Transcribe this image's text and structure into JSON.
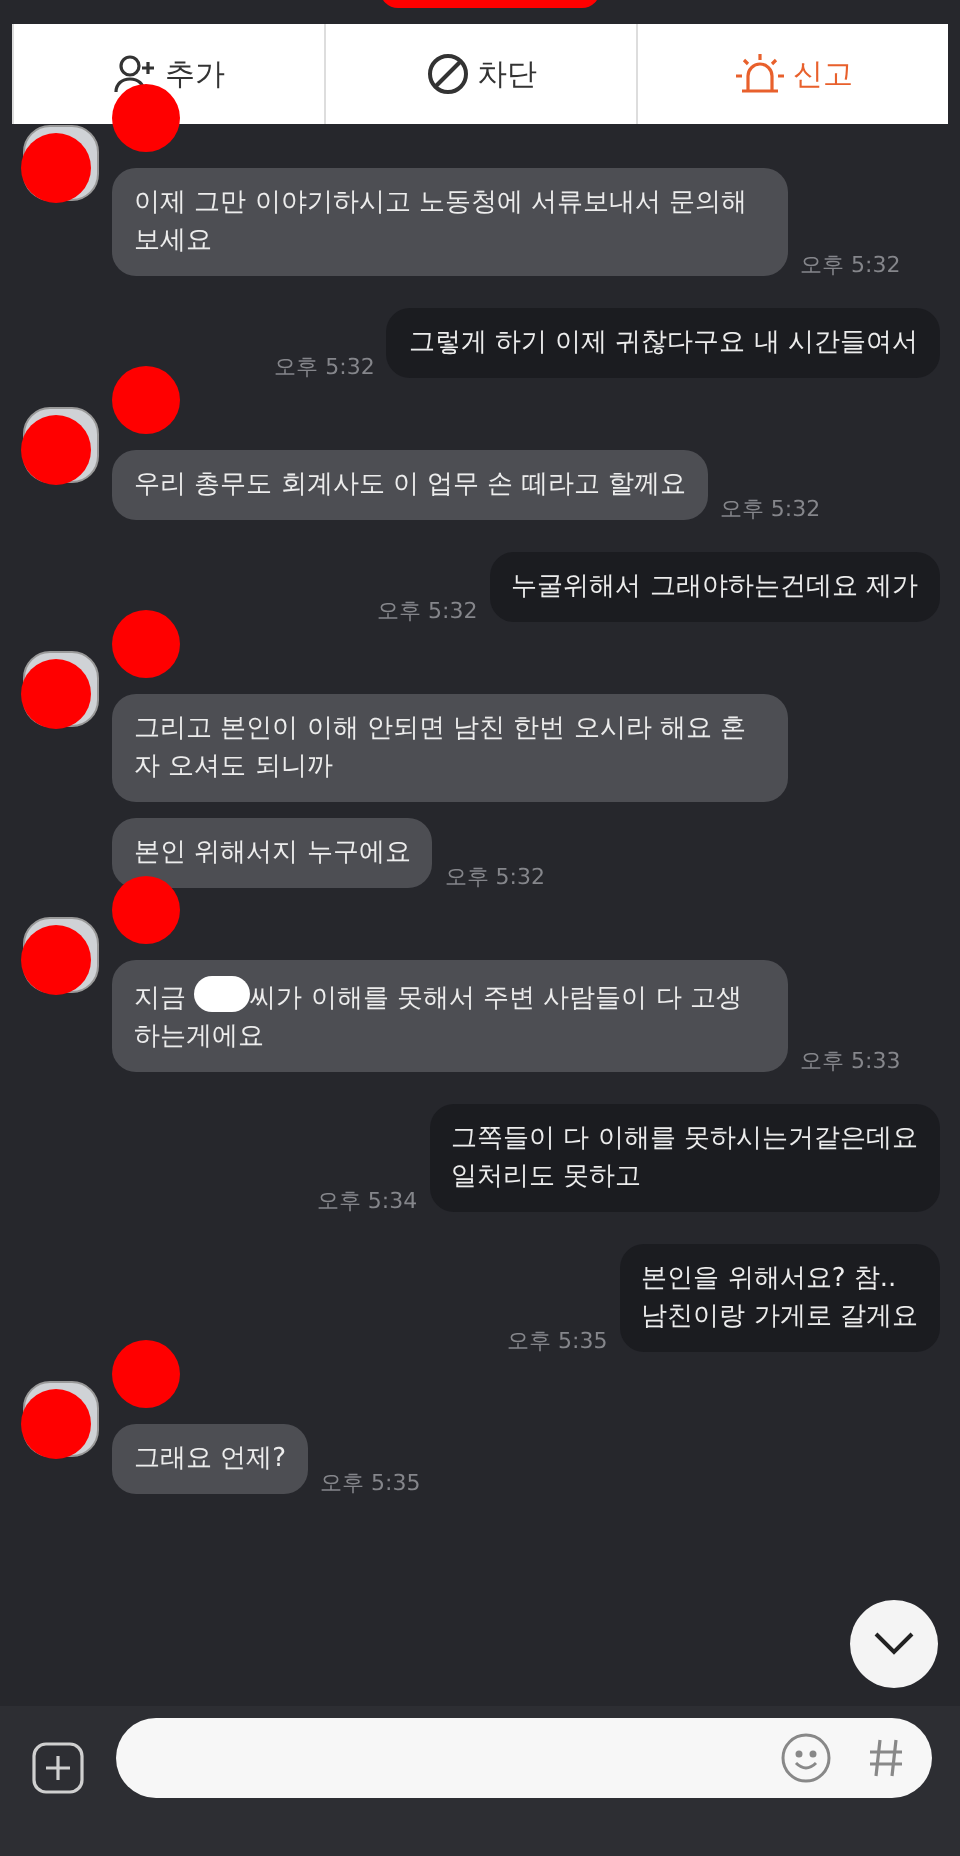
{
  "top_redaction": true,
  "actions": [
    {
      "kind": "add",
      "label": "추가",
      "color": "#333333"
    },
    {
      "kind": "block",
      "label": "차단",
      "color": "#333333"
    },
    {
      "kind": "report",
      "label": "신고",
      "color": "#e8602c"
    }
  ],
  "messages": [
    {
      "kind": "received",
      "avatar": true,
      "parts": [
        {
          "kind": "text",
          "text": "이제 그만 이야기하시고 노동청에 서류보내서 문의해보세요"
        }
      ],
      "time": "오후 5:32"
    },
    {
      "kind": "sent",
      "parts": [
        {
          "kind": "text",
          "text": "그렇게 하기 이제 귀찮다구요 내 시간들여서"
        }
      ],
      "time": "오후 5:32"
    },
    {
      "kind": "received",
      "avatar": true,
      "parts": [
        {
          "kind": "text",
          "text": "우리 총무도 회계사도 이 업무 손 떼라고 할께요"
        }
      ],
      "time": "오후 5:32"
    },
    {
      "kind": "sent",
      "parts": [
        {
          "kind": "text",
          "text": "누굴위해서 그래야하는건데요 제가"
        }
      ],
      "time": "오후 5:32"
    },
    {
      "kind": "received",
      "avatar": true,
      "parts": [
        {
          "kind": "text",
          "text": "그리고 본인이 이해 안되면 남친 한번 오시라 해요 혼자 오셔도 되니까"
        }
      ]
    },
    {
      "kind": "received",
      "avatar": false,
      "parts": [
        {
          "kind": "text",
          "text": "본인 위해서지 누구에요"
        }
      ],
      "time": "오후 5:32"
    },
    {
      "kind": "received",
      "avatar": true,
      "parts": [
        {
          "kind": "text",
          "text": "지금 "
        },
        {
          "kind": "redaction"
        },
        {
          "kind": "text",
          "text": "씨가 이해를 못해서 주변 사람들이 다 고생하는게에요"
        }
      ],
      "time": "오후 5:33"
    },
    {
      "kind": "sent",
      "parts": [
        {
          "kind": "text",
          "text": "그쪽들이 다 이해를 못하시는거같은데요\n일처리도 못하고"
        }
      ],
      "time": "오후 5:34"
    },
    {
      "kind": "sent",
      "parts": [
        {
          "kind": "text",
          "text": "본인을 위해서요? 참..\n남친이랑 가게로 갈게요"
        }
      ],
      "time": "오후 5:35"
    },
    {
      "kind": "received",
      "avatar": true,
      "parts": [
        {
          "kind": "text",
          "text": "그래요 언제?"
        }
      ],
      "time": "오후 5:35"
    }
  ],
  "composer": {
    "emoji": true,
    "hashtag": true
  }
}
